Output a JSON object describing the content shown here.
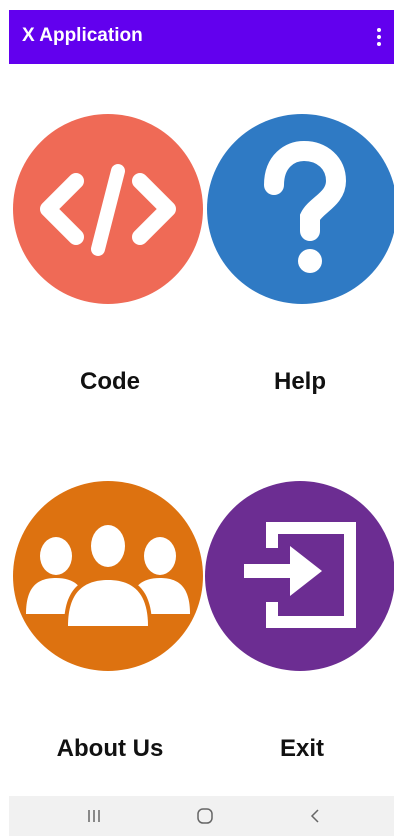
{
  "app_bar": {
    "title": "X Application",
    "overflow_icon": "more-vert-icon",
    "color": "#6200ee"
  },
  "tiles": [
    {
      "label": "Code",
      "icon": "code-icon",
      "color": "#ef6a56"
    },
    {
      "label": "Help",
      "icon": "question-mark-icon",
      "color": "#2f7ac4"
    },
    {
      "label": "About Us",
      "icon": "group-icon",
      "color": "#dd7210"
    },
    {
      "label": "Exit",
      "icon": "exit-icon",
      "color": "#6c2d92"
    }
  ],
  "nav_bar": {
    "recents_icon": "recents-icon",
    "home_icon": "home-icon",
    "back_icon": "back-icon"
  }
}
